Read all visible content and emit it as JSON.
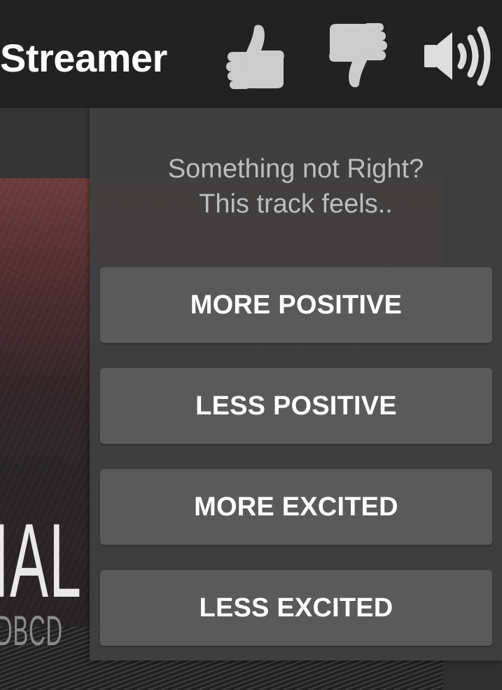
{
  "app": {
    "title": "Streamer"
  },
  "toolbar": {
    "like": {
      "icon": "thumbs-up-icon",
      "color": "#cccccc"
    },
    "dislike": {
      "icon": "thumbs-down-icon",
      "color": "#cccccc"
    },
    "volume": {
      "icon": "volume-icon",
      "color": "#dddddd"
    }
  },
  "album_art": {
    "visible_text": "IAL",
    "visible_subtext": "DBCD"
  },
  "feedback_popup": {
    "prompt_line1": "Something not Right?",
    "prompt_line2": "This track feels..",
    "options": [
      {
        "label": "MORE POSITIVE"
      },
      {
        "label": "LESS POSITIVE"
      },
      {
        "label": "MORE EXCITED"
      },
      {
        "label": "LESS EXCITED"
      }
    ]
  },
  "colors": {
    "appbar_bg": "#222222",
    "popup_bg": "#404040",
    "button_bg": "#5a5a5b",
    "button_text": "#ffffff",
    "prompt_text": "#bdbdbd"
  }
}
